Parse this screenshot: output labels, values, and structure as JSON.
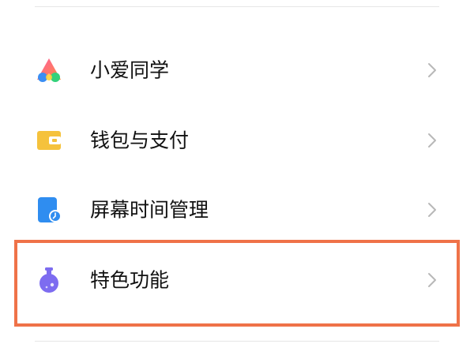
{
  "settings": {
    "items": [
      {
        "label": "小爱同学",
        "icon": "xiaoai-assistant-icon"
      },
      {
        "label": "钱包与支付",
        "icon": "wallet-icon"
      },
      {
        "label": "屏幕时间管理",
        "icon": "screen-time-icon"
      },
      {
        "label": "特色功能",
        "icon": "special-features-flask-icon"
      }
    ],
    "highlighted_item": "特色功能"
  },
  "colors": {
    "highlight_border": "#ef7248",
    "wallet": "#f5c23c",
    "screen_time": "#2f8df0",
    "special_features": "#7d6cf0",
    "chevron": "#b8b8b8"
  }
}
